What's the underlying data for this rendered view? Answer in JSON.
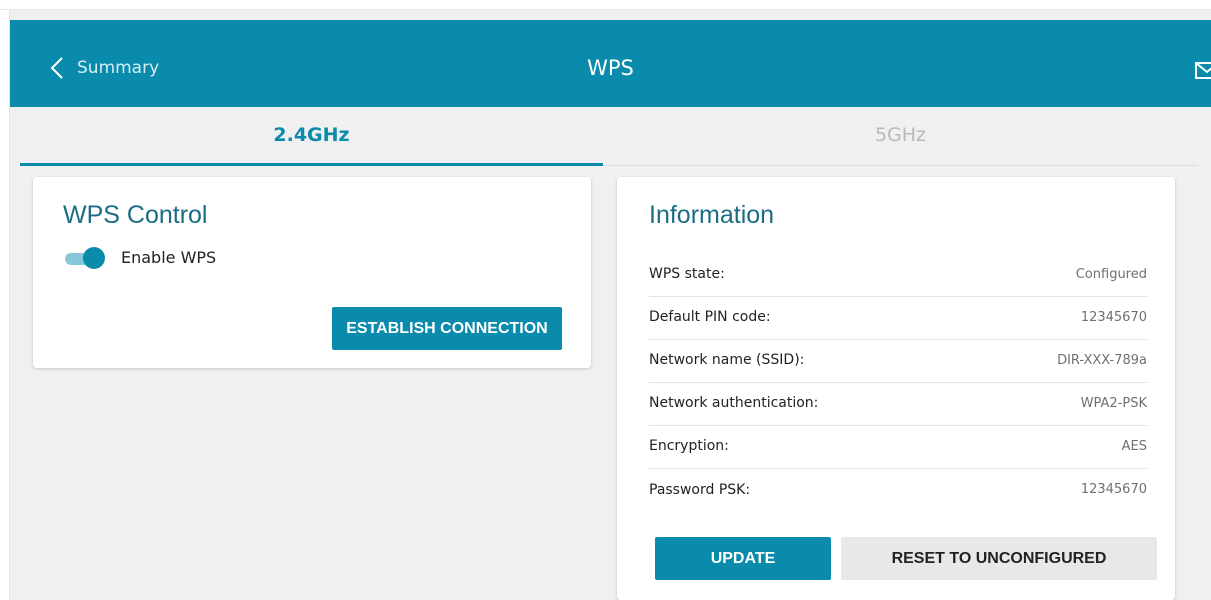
{
  "header": {
    "back_label": "Summary",
    "title": "WPS",
    "color": "#0a8bab"
  },
  "tabs": [
    {
      "label": "2.4GHz",
      "active": true
    },
    {
      "label": "5GHz",
      "active": false
    }
  ],
  "wps_control": {
    "title": "WPS Control",
    "enable_label": "Enable WPS",
    "enabled": true,
    "establish_label": "ESTABLISH CONNECTION"
  },
  "information": {
    "title": "Information",
    "rows": [
      {
        "label": "WPS state:",
        "value": "Configured"
      },
      {
        "label": "Default PIN code:",
        "value": "12345670"
      },
      {
        "label": "Network name (SSID):",
        "value": "DIR-XXX-789a"
      },
      {
        "label": "Network authentication:",
        "value": "WPA2-PSK"
      },
      {
        "label": "Encryption:",
        "value": "AES"
      },
      {
        "label": "Password PSK:",
        "value": "12345670"
      }
    ],
    "update_label": "UPDATE",
    "reset_label": "RESET TO UNCONFIGURED"
  },
  "icons": {
    "back": "chevron-left-icon",
    "mail": "mail-icon"
  }
}
